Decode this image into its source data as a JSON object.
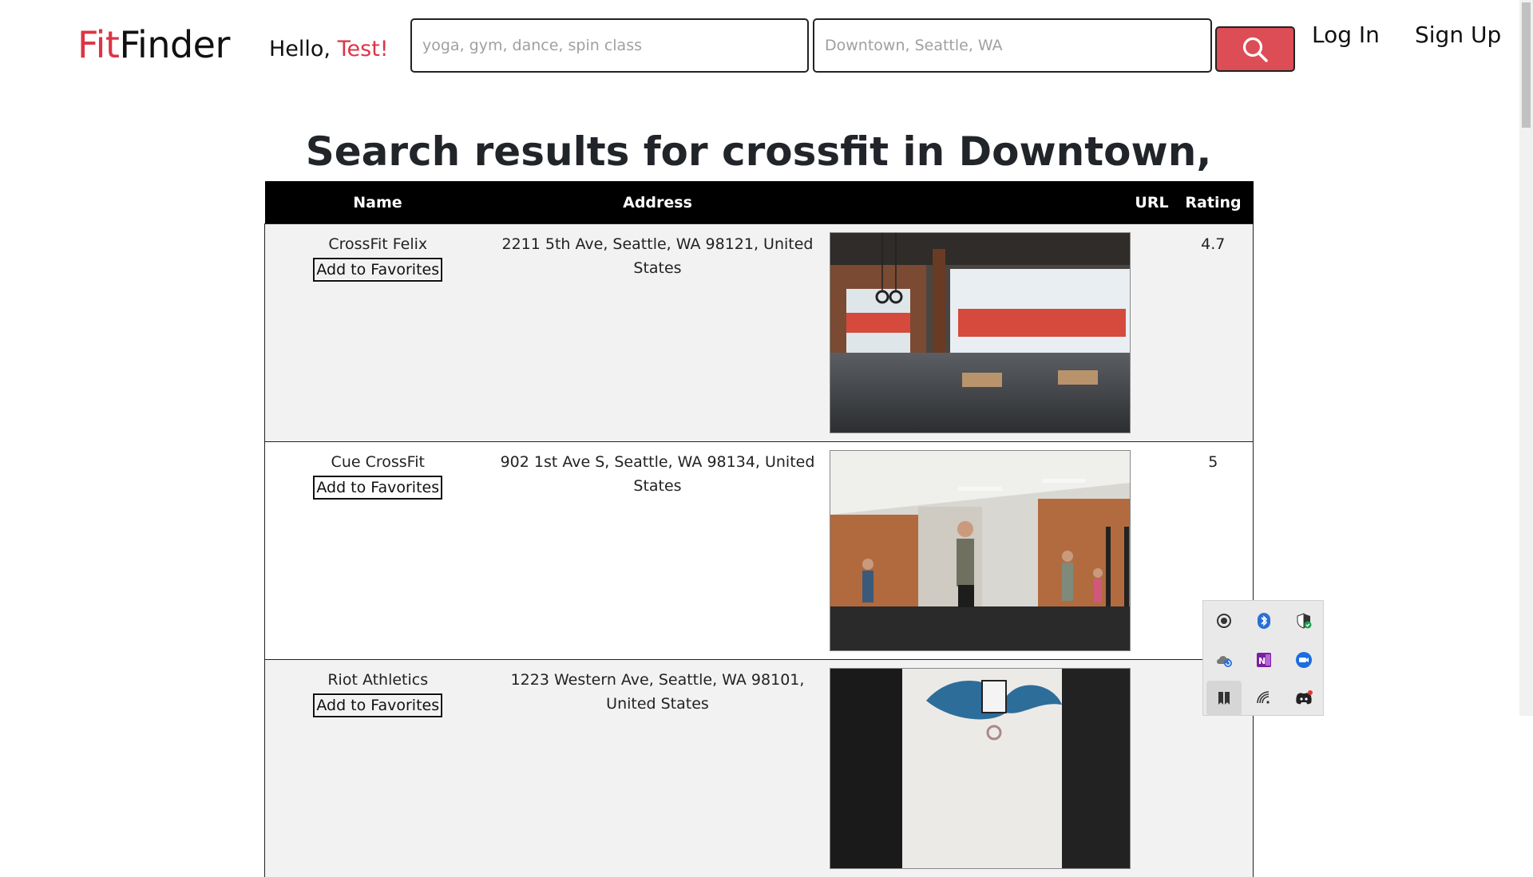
{
  "header": {
    "logo_fit": "Fit",
    "logo_finder": "Finder",
    "hello_prefix": "Hello, ",
    "user_name": "Test!",
    "search_placeholder": "yoga, gym, dance, spin class",
    "location_placeholder": "Downtown, Seattle, WA",
    "login_label": "Log In",
    "signup_label": "Sign Up"
  },
  "page_title": "Search results for crossfit in Downtown, Seattle, WA",
  "table": {
    "columns": [
      "Name",
      "Address",
      "",
      "URL",
      "Rating"
    ],
    "favorite_label": "Add to Favorites",
    "rows": [
      {
        "name": "CrossFit Felix",
        "address": "2211 5th Ave, Seattle, WA 98121, United States",
        "image": "gym-interior-photo",
        "url": "",
        "rating": "4.7"
      },
      {
        "name": "Cue CrossFit",
        "address": "902 1st Ave S, Seattle, WA 98134, United States",
        "image": "gym-class-photo",
        "url": "",
        "rating": "5"
      },
      {
        "name": "Riot Athletics",
        "address": "1223 Western Ave, Seattle, WA 98101, United States",
        "image": "gym-logo-photo",
        "url": "",
        "rating": ""
      }
    ]
  },
  "tray_icons": [
    "record-icon",
    "bluetooth-icon",
    "security-shield-icon",
    "onedrive-sync-icon",
    "onenote-icon",
    "zoom-icon",
    "bookmark-icon",
    "wifi-icon",
    "discord-icon"
  ],
  "colors": {
    "accent": "#dc3545",
    "search_button": "#dc4d55",
    "header_row": "#000000",
    "odd_row": "#f2f2f2"
  }
}
